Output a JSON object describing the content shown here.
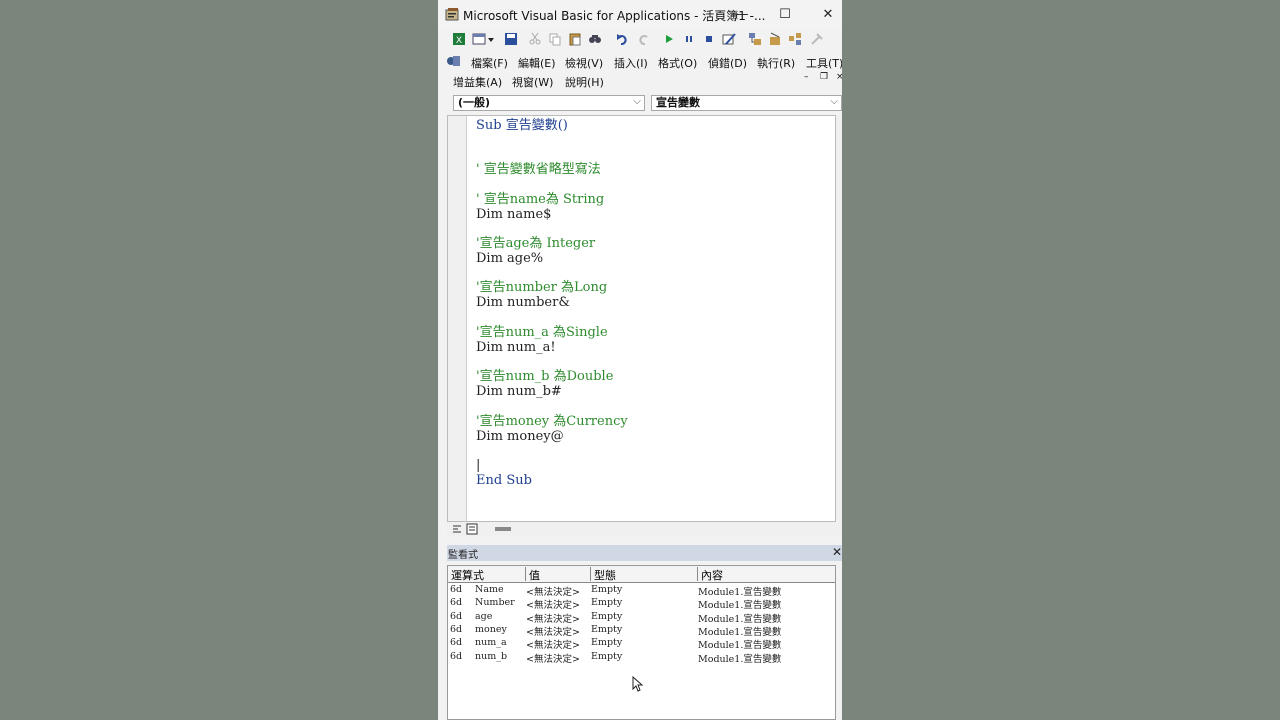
{
  "window": {
    "title": "Microsoft Visual Basic for Applications - 活頁簿1 -...",
    "minimize_glyph": "—",
    "maximize_glyph": "☐",
    "close_glyph": "✕"
  },
  "toolbar": {
    "icons": [
      "excel-icon",
      "insert-module-icon",
      "dropdown-arrow-icon",
      "save-icon",
      "cut-icon",
      "copy-icon",
      "paste-icon",
      "find-icon",
      "undo-icon",
      "redo-icon",
      "run-icon",
      "break-icon",
      "reset-icon",
      "design-mode-icon",
      "project-explorer-icon",
      "properties-icon",
      "object-browser-icon",
      "toolbox-icon"
    ]
  },
  "menu": {
    "row1": [
      "檔案(F)",
      "編輯(E)",
      "檢視(V)",
      "插入(I)",
      "格式(O)",
      "偵錯(D)",
      "執行(R)",
      "工具(T)"
    ],
    "row2": [
      "增益集(A)",
      "視窗(W)",
      "說明(H)"
    ]
  },
  "object_combo": {
    "value": "(一般)"
  },
  "procedure_combo": {
    "value": "宣告變數"
  },
  "code": {
    "lines": [
      {
        "text": "Sub 宣告變數()",
        "kind": "kw"
      },
      {
        "text": "' 宣告變數省略型寫法",
        "kind": "cm"
      },
      {
        "text": "' 宣告name為 String",
        "kind": "cm"
      },
      {
        "text": "Dim name$",
        "kind": "pl"
      },
      {
        "text": "'宣告age為 Integer",
        "kind": "cm"
      },
      {
        "text": "Dim age%",
        "kind": "pl"
      },
      {
        "text": "'宣告number 為Long",
        "kind": "cm"
      },
      {
        "text": "Dim number&",
        "kind": "pl"
      },
      {
        "text": "'宣告num_a 為Single",
        "kind": "cm"
      },
      {
        "text": "Dim num_a!",
        "kind": "pl"
      },
      {
        "text": "'宣告num_b 為Double",
        "kind": "cm"
      },
      {
        "text": "Dim num_b#",
        "kind": "pl"
      },
      {
        "text": "'宣告money 為Currency",
        "kind": "cm"
      },
      {
        "text": "Dim money@",
        "kind": "pl"
      },
      {
        "text": "|",
        "kind": "pl"
      },
      {
        "text": "End Sub",
        "kind": "kw"
      }
    ]
  },
  "watch": {
    "title": "監看式",
    "close_glyph": "✕",
    "columns": [
      "運算式",
      "值",
      "型態",
      "內容"
    ],
    "rows": [
      {
        "icon": "6d",
        "expr": "Name",
        "value": "<無法決定>",
        "type": "Empty",
        "context": "Module1.宣告變數"
      },
      {
        "icon": "6d",
        "expr": "Number",
        "value": "<無法決定>",
        "type": "Empty",
        "context": "Module1.宣告變數"
      },
      {
        "icon": "6d",
        "expr": "age",
        "value": "<無法決定>",
        "type": "Empty",
        "context": "Module1.宣告變數"
      },
      {
        "icon": "6d",
        "expr": "money",
        "value": "<無法決定>",
        "type": "Empty",
        "context": "Module1.宣告變數"
      },
      {
        "icon": "6d",
        "expr": "num_a",
        "value": "<無法決定>",
        "type": "Empty",
        "context": "Module1.宣告變數"
      },
      {
        "icon": "6d",
        "expr": "num_b",
        "value": "<無法決定>",
        "type": "Empty",
        "context": "Module1.宣告變數"
      }
    ]
  },
  "colors": {
    "keyword": "#1f3f8f",
    "comment": "#2e8b2e",
    "background": "#7c857c"
  }
}
